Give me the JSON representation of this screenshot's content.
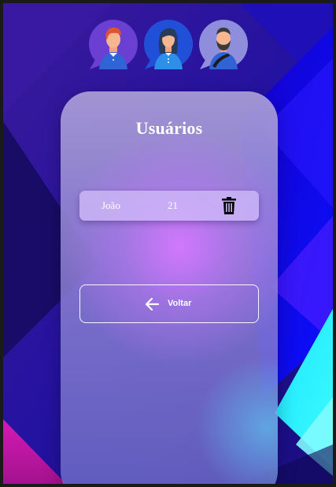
{
  "avatars": [
    {
      "icon": "man-red-hair-avatar-icon"
    },
    {
      "icon": "woman-avatar-icon"
    },
    {
      "icon": "bearded-man-avatar-icon"
    }
  ],
  "card": {
    "title": "Usuários"
  },
  "users": [
    {
      "name": "João",
      "age": "21",
      "delete_icon": "trash-icon"
    }
  ],
  "back_button": {
    "label": "Voltar",
    "icon": "arrow-left-icon"
  },
  "colors": {
    "background_dark": "#1b0c6a",
    "background_blue": "#1a1ff0",
    "accent_cyan": "#2ff3ff",
    "accent_magenta": "#e016b8",
    "text": "#ffffff"
  }
}
